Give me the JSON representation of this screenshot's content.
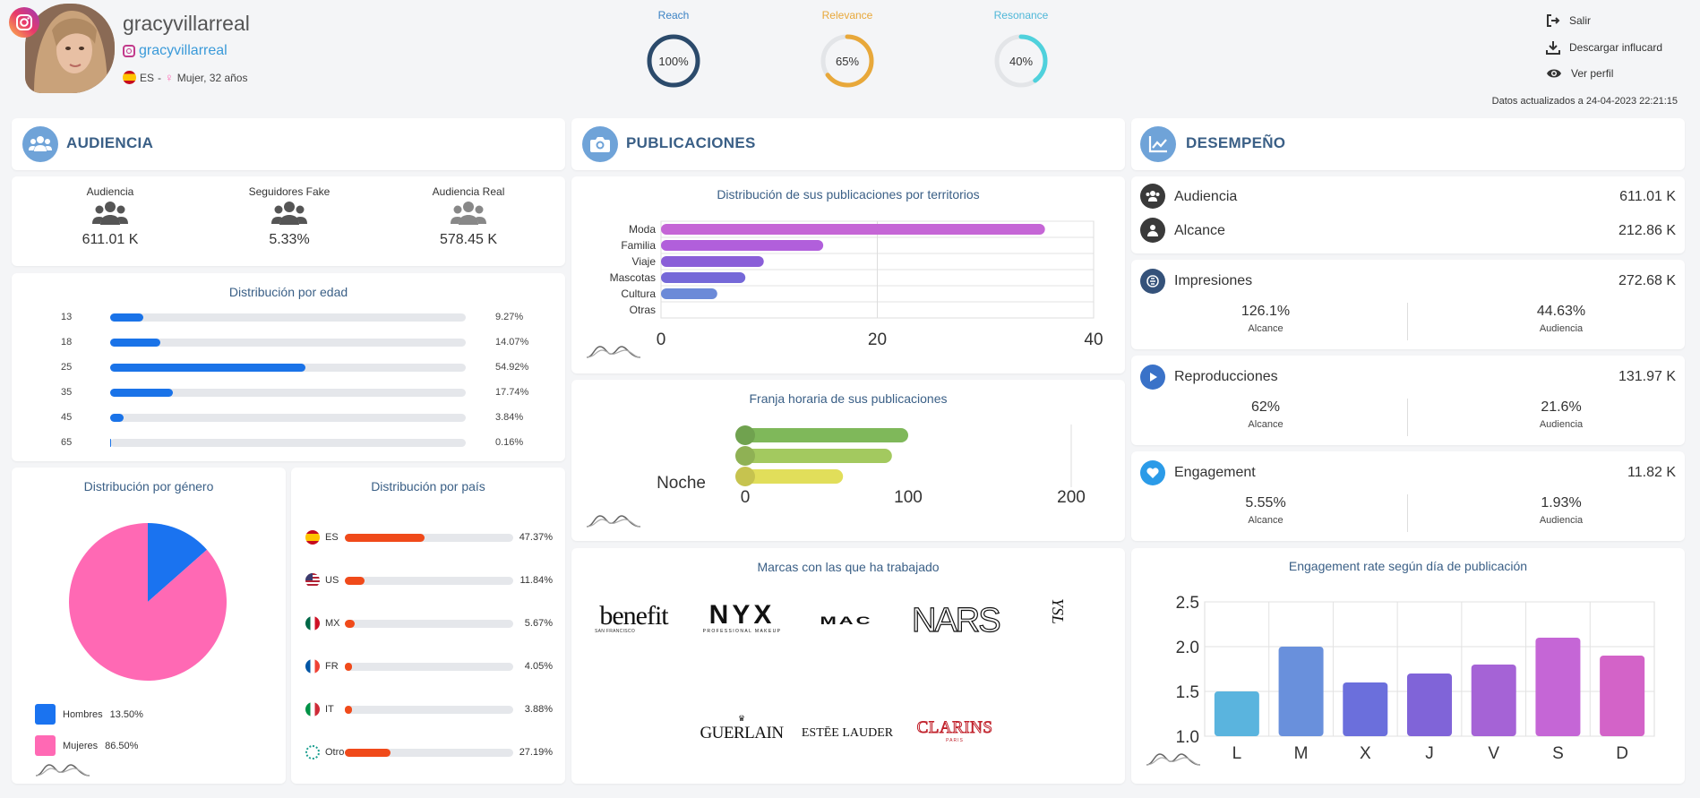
{
  "header": {
    "username": "gracyvillarreal",
    "handle": "gracyvillarreal",
    "country": "ES",
    "demographic": "Mujer, 32 años",
    "gauges": [
      {
        "label": "Reach",
        "value": "100%",
        "pct": 100,
        "color": "#2b4a6b",
        "labelColor": "#3b82c4"
      },
      {
        "label": "Relevance",
        "value": "65%",
        "pct": 65,
        "color": "#e8a83a",
        "labelColor": "#e8a83a"
      },
      {
        "label": "Resonance",
        "value": "40%",
        "pct": 40,
        "color": "#4fd1dc",
        "labelColor": "#4fb7d8"
      }
    ],
    "links": {
      "exit": "Salir",
      "download": "Descargar influcard",
      "profile": "Ver perfil"
    },
    "updated": "Datos actualizados a 24-04-2023 22:21:15"
  },
  "audiencia": {
    "title": "AUDIENCIA",
    "stats": [
      {
        "label": "Audiencia",
        "value": "611.01 K"
      },
      {
        "label": "Seguidores Fake",
        "value": "5.33%"
      },
      {
        "label": "Audiencia Real",
        "value": "578.45 K"
      }
    ],
    "age_title": "Distribución por edad",
    "ages": [
      {
        "label": "13",
        "value": "9.27%",
        "pct": 9.27
      },
      {
        "label": "18",
        "value": "14.07%",
        "pct": 14.07
      },
      {
        "label": "25",
        "value": "54.92%",
        "pct": 54.92
      },
      {
        "label": "35",
        "value": "17.74%",
        "pct": 17.74
      },
      {
        "label": "45",
        "value": "3.84%",
        "pct": 3.84
      },
      {
        "label": "65",
        "value": "0.16%",
        "pct": 0.16
      }
    ],
    "gender_title": "Distribución por género",
    "genders": [
      {
        "label": "Hombres",
        "value": "13.50%",
        "pct": 13.5,
        "color": "#1a73f0"
      },
      {
        "label": "Mujeres",
        "value": "86.50%",
        "pct": 86.5,
        "color": "#ff69b4"
      }
    ],
    "country_title": "Distribución por país",
    "countries": [
      {
        "code": "ES",
        "value": "47.37%",
        "pct": 47.37
      },
      {
        "code": "US",
        "value": "11.84%",
        "pct": 11.84
      },
      {
        "code": "MX",
        "value": "5.67%",
        "pct": 5.67
      },
      {
        "code": "FR",
        "value": "4.05%",
        "pct": 4.05
      },
      {
        "code": "IT",
        "value": "3.88%",
        "pct": 3.88
      },
      {
        "code": "Otro",
        "value": "27.19%",
        "pct": 27.19
      }
    ]
  },
  "publicaciones": {
    "title": "PUBLICACIONES",
    "territories_title": "Distribución de sus publicaciones por territorios",
    "hours_title": "Franja horaria de sus publicaciones",
    "brands_title": "Marcas con las que ha trabajado",
    "brands_row1": [
      "benefit",
      "NYX",
      "MAC",
      "NARS",
      "YSL"
    ],
    "brands_row2": [
      "GUERLAIN",
      "ESTĒE LAUDER",
      "CLARINS"
    ],
    "brand_subs": {
      "benefit": "SAN FRANCISCO",
      "nyx": "PROFESSIONAL MAKEUP",
      "clarins": "PARIS"
    }
  },
  "desempeno": {
    "title": "DESEMPEÑO",
    "audiencia": {
      "label": "Audiencia",
      "value": "611.01 K"
    },
    "alcance": {
      "label": "Alcance",
      "value": "212.86 K"
    },
    "blocks": [
      {
        "label": "Impresiones",
        "value": "272.68 K",
        "left": "126.1%",
        "left_label": "Alcance",
        "right": "44.63%",
        "right_label": "Audiencia"
      },
      {
        "label": "Reproducciones",
        "value": "131.97 K",
        "left": "62%",
        "left_label": "Alcance",
        "right": "21.6%",
        "right_label": "Audiencia"
      },
      {
        "label": "Engagement",
        "value": "11.82 K",
        "left": "5.55%",
        "left_label": "Alcance",
        "right": "1.93%",
        "right_label": "Audiencia"
      }
    ],
    "er_title": "Engagement rate según día de publicación"
  },
  "chart_data": [
    {
      "type": "bar",
      "orientation": "horizontal",
      "title": "Distribución de sus publicaciones por territorios",
      "categories": [
        "Moda",
        "Familia",
        "Viaje",
        "Mascotas",
        "Cultura",
        "Otras"
      ],
      "values": [
        35.5,
        15,
        9.5,
        7.8,
        5.2,
        0
      ],
      "colors": [
        "#c566d6",
        "#b15fdb",
        "#8a5ed8",
        "#7568d8",
        "#6b8ad8",
        "#6b8ad8"
      ],
      "xlim": [
        0,
        40
      ],
      "xticks": [
        0,
        20,
        40
      ]
    },
    {
      "type": "bar",
      "orientation": "horizontal",
      "title": "Franja horaria de sus publicaciones",
      "categories": [
        "Noche"
      ],
      "series": [
        {
          "values": [
            100
          ],
          "color": "#7fb85a"
        },
        {
          "values": [
            90
          ],
          "color": "#a3c95f"
        },
        {
          "values": [
            60
          ],
          "color": "#e1de5a"
        }
      ],
      "xlim": [
        0,
        200
      ],
      "xticks": [
        0,
        100,
        200
      ]
    },
    {
      "type": "bar",
      "title": "Engagement rate según día de publicación",
      "categories": [
        "L",
        "M",
        "X",
        "J",
        "V",
        "S",
        "D"
      ],
      "values": [
        1.5,
        2.0,
        1.6,
        1.7,
        1.8,
        2.1,
        1.9
      ],
      "colors": [
        "#5ab4de",
        "#6990dc",
        "#6b6fdc",
        "#8064d8",
        "#a563d6",
        "#c566d6",
        "#d363c8"
      ],
      "ylim": [
        1.0,
        2.5
      ],
      "yticks": [
        "1.0",
        "1.5",
        "2.0",
        "2.5"
      ]
    }
  ]
}
